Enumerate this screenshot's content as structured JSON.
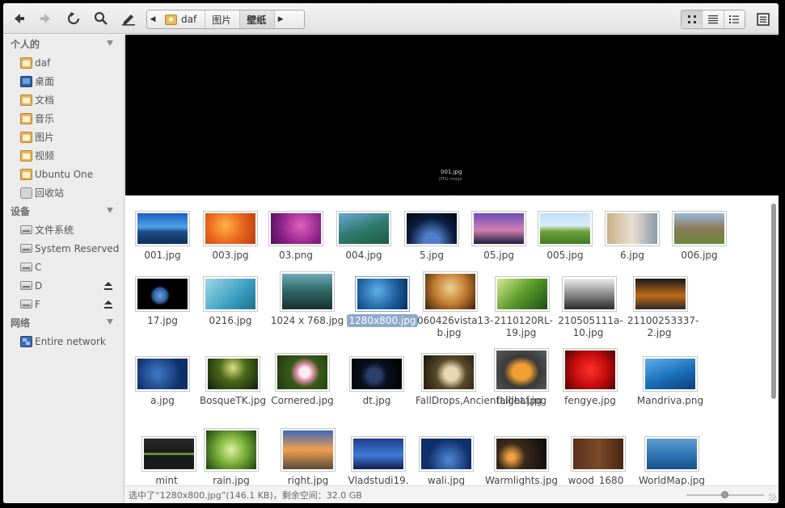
{
  "toolbar": {
    "breadcrumb": [
      "daf",
      "图片",
      "壁纸"
    ]
  },
  "sidebar": {
    "sections": [
      {
        "title": "个人的",
        "items": [
          {
            "label": "daf",
            "icon": "home-folder-icon"
          },
          {
            "label": "桌面",
            "icon": "desktop-icon"
          },
          {
            "label": "文档",
            "icon": "documents-folder-icon"
          },
          {
            "label": "音乐",
            "icon": "music-folder-icon"
          },
          {
            "label": "图片",
            "icon": "pictures-folder-icon"
          },
          {
            "label": "视频",
            "icon": "videos-folder-icon"
          },
          {
            "label": "Ubuntu One",
            "icon": "folder-icon"
          },
          {
            "label": "回收站",
            "icon": "trash-icon"
          }
        ]
      },
      {
        "title": "设备",
        "items": [
          {
            "label": "文件系统",
            "icon": "drive-icon"
          },
          {
            "label": "System Reserved",
            "icon": "drive-icon"
          },
          {
            "label": "C",
            "icon": "drive-icon"
          },
          {
            "label": "D",
            "icon": "drive-icon"
          },
          {
            "label": "F",
            "icon": "drive-icon"
          }
        ]
      },
      {
        "title": "网络",
        "items": [
          {
            "label": "Entire network",
            "icon": "network-icon"
          }
        ]
      }
    ]
  },
  "preview": {
    "filename": "001.jpg",
    "type_label": "JPEG image"
  },
  "files": [
    {
      "name": "001.jpg",
      "grad": "linear-gradient(#1d5fbf 0%, #4fa3e8 45%, #1f4f8a 60%, #0d2f5a 100%)"
    },
    {
      "name": "003.jpg",
      "grad": "radial-gradient(circle at 40% 40%, #ffb347, #e8651e 50%, #b63d0c)"
    },
    {
      "name": "03.png",
      "grad": "radial-gradient(circle at 60% 40%, #e05fc0, #8a1f86 60%, #4a0f55)"
    },
    {
      "name": "004.jpg",
      "grad": "linear-gradient(160deg, #6ea6d8, #2d7c6e 50%, #1d5a3f)"
    },
    {
      "name": "5.jpg",
      "grad": "radial-gradient(circle at 50% 90%, #4f7dc9 20%, #0b1d3f 60%, #02060f)"
    },
    {
      "name": "05.jpg",
      "grad": "linear-gradient(#6b4fb8, #d27fb2 55%, #1d1d3a)"
    },
    {
      "name": "005.jpg",
      "grad": "linear-gradient(#bfe0f5 0%, #d8ecf6 40%, #6ea33a 60%, #3f7a24)"
    },
    {
      "name": "6.jpg",
      "grad": "linear-gradient(90deg, #c9b08a, #e8e0d0 50%, #8a9aa8)"
    },
    {
      "name": "006.jpg",
      "grad": "linear-gradient(#9ab8d6, #8a7a5a 50%, #6b8a3a)"
    },
    {
      "name": "17.jpg",
      "grad": "radial-gradient(circle at 45% 55%, #6fa0e0 0%, #2c5aa0 22%, #000 30%)"
    },
    {
      "name": "0216.jpg",
      "grad": "linear-gradient(135deg, #9fd8e8, #3a9fc0 60%, #1e6f8a)"
    },
    {
      "name": "1024 x 768.jpg",
      "grad": "linear-gradient(#6fa8b8, #2f6c6a 45%, #1a2f2a)"
    },
    {
      "name": "1280x800.jpg",
      "grad": "radial-gradient(circle at 40% 40%, #5fb0e8, #1d5fa0 55%, #0a2a55)"
    },
    {
      "name": "060426vista13-b.jpg",
      "grad": "radial-gradient(circle at 50% 40%, #f0d090, #c07a30 50%, #3a1f0a)"
    },
    {
      "name": "2110120RL-19.jpg",
      "grad": "linear-gradient(135deg, #d8e890, #5a9a2a 50%, #1f4f1a)"
    },
    {
      "name": "210505111a-10.jpg",
      "grad": "linear-gradient(#ececec, #7a7a7a 60%, #2a2a2a)"
    },
    {
      "name": "21100253337-2.jpg",
      "grad": "linear-gradient(#1a1a1a, #c06a1a 55%, #2a2a2a)"
    },
    {
      "name": "a.jpg",
      "grad": "radial-gradient(circle at 40% 50%, #3f7ac8, #0f2f6a 70%)"
    },
    {
      "name": "BosqueTK.jpg",
      "grad": "radial-gradient(circle at 50% 30%, #e0e080, #4a6a1a 40%, #0f1f0a)"
    },
    {
      "name": "Cornered.jpg",
      "grad": "radial-gradient(circle at 55% 50%, #f8f0f0 15%, #e890b0 25%, #3a5a1a 45%, #1f3a0f)"
    },
    {
      "name": "dt.jpg",
      "grad": "radial-gradient(circle at 45% 55%, #2a3f6a 20%, #0a0f1f 40%, #000)"
    },
    {
      "name": "FallDrops,AncientLight.jpg",
      "grad": "radial-gradient(circle at 55% 55%, #e8d8b0 20%, #5a4a2a 45%, #1a140a)"
    },
    {
      "name": "fallleaf.jpg",
      "grad": "radial-gradient(ellipse at 50% 55%, #f0a030 25%, #3a3a3a 50%, #5a5a5a)"
    },
    {
      "name": "fengye.jpg",
      "grad": "radial-gradient(circle at 50% 50%, #ff3030, #c00a0a 55%, #4a0505)"
    },
    {
      "name": "Mandriva.png",
      "grad": "linear-gradient(160deg, #5fb0e8, #1a6fb8 55%, #0a3f7a)"
    },
    {
      "name": "mint_",
      "grad": "linear-gradient(#2a2a2a, #1a1a1a 45%, #8fcf4f 50%, #1a1a1a 55%)"
    },
    {
      "name": "rain.jpg",
      "grad": "radial-gradient(circle at 50% 50%, #e0f0a0, #7ab03a 45%, #1f3f0f)"
    },
    {
      "name": "right.jpg",
      "grad": "linear-gradient(#3f6ab8, #f0a050 50%, #5a4a3a)"
    },
    {
      "name": "Vladstudi19.",
      "grad": "linear-gradient(#1f3f8a, #3f7ad8 55%, #0f1f4a)"
    },
    {
      "name": "wali.jpg",
      "grad": "radial-gradient(circle at 55% 70%, #4f8ad8, #0f2f6a 60%)"
    },
    {
      "name": "Warmlights.jpg",
      "grad": "radial-gradient(circle at 30% 60%, #f0a040 8%, #3a2a1a 35%, #0a0a0a)"
    },
    {
      "name": "wood_1680_",
      "grad": "linear-gradient(90deg, #5a2f1a, #7a4a2a 50%, #4a2510)"
    },
    {
      "name": "WorldMap.jpg",
      "grad": "linear-gradient(#5f9fd0, #2a6fb0 60%, #1a4f8a)"
    }
  ],
  "status": {
    "text": "选中了“1280x800.jpg”(146.1 KB)，剩余空间：32.0 GB"
  },
  "zoom_level": 0.5
}
